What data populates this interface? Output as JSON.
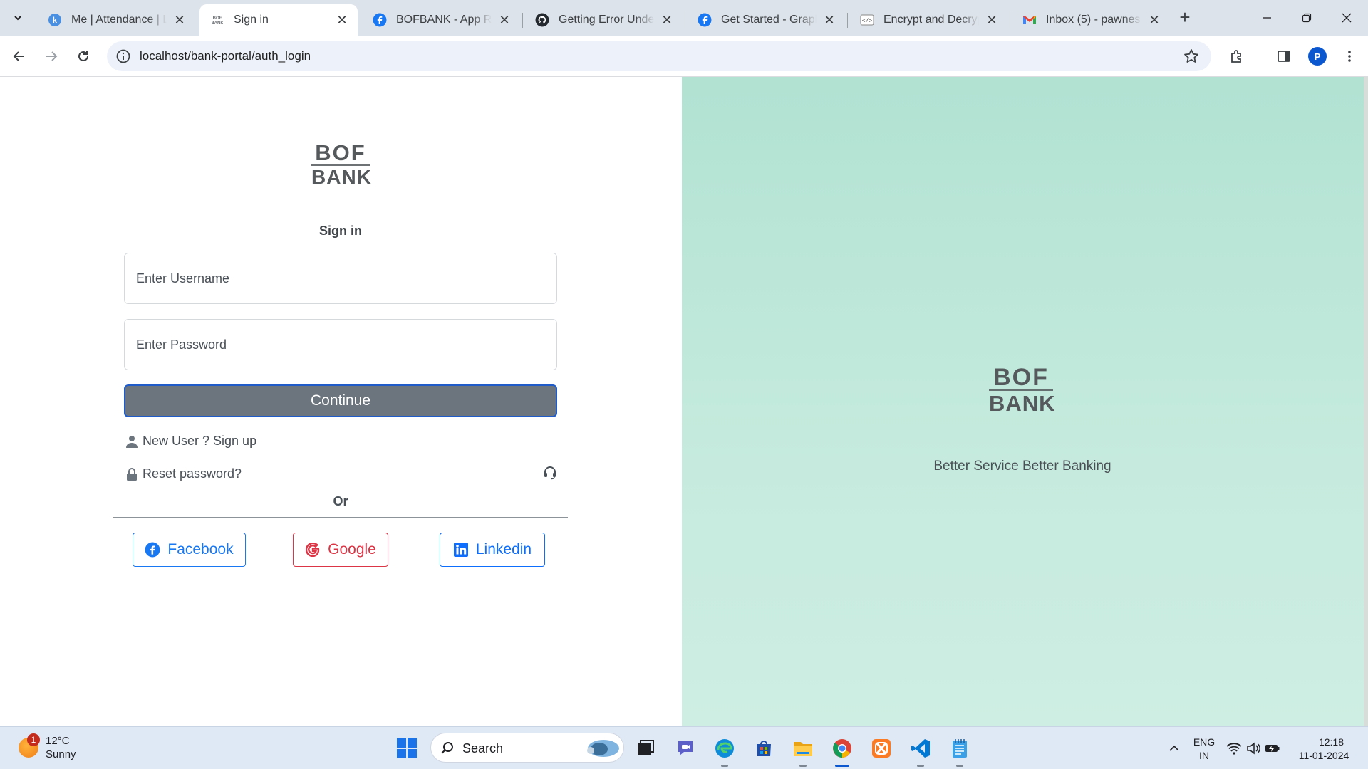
{
  "browser": {
    "tabs": [
      {
        "title": "Me | Attendance | Lo",
        "favicon": "k-circle-icon",
        "active": false
      },
      {
        "title": "Sign in",
        "favicon": "bofbank-favicon",
        "active": true
      },
      {
        "title": "BOFBANK - App Revi",
        "favicon": "facebook-icon",
        "active": false
      },
      {
        "title": "Getting Error Undefi",
        "favicon": "github-icon",
        "active": false
      },
      {
        "title": "Get Started - Graph",
        "favicon": "facebook-icon",
        "active": false
      },
      {
        "title": "Encrypt and Decrypt",
        "favicon": "code-icon",
        "active": false
      },
      {
        "title": "Inbox (5) - pawneshk",
        "favicon": "gmail-icon",
        "active": false
      }
    ],
    "url": "localhost/bank-portal/auth_login",
    "profile_initial": "P"
  },
  "left_logo": {
    "line1": "BOF",
    "line2": "BANK"
  },
  "signin": {
    "title": "Sign in",
    "username_placeholder": "Enter Username",
    "password_placeholder": "Enter Password",
    "continue_label": "Continue",
    "signup_link": "New User ? Sign up",
    "reset_link": "Reset password?",
    "or_label": "Or"
  },
  "social": {
    "facebook": "Facebook",
    "google": "Google",
    "linkedin": "Linkedin"
  },
  "right_panel": {
    "logo": {
      "line1": "BOF",
      "line2": "BANK"
    },
    "tagline": "Better Service Better Banking"
  },
  "taskbar": {
    "weather_temp": "12°C",
    "weather_desc": "Sunny",
    "weather_badge": "1",
    "search_label": "Search",
    "lang_top": "ENG",
    "lang_bottom": "IN",
    "time": "12:18",
    "date": "11-01-2024"
  },
  "colors": {
    "right_panel_bg": "#b1e2d2",
    "continue_bg": "#6c757d",
    "facebook": "#1877f2",
    "google": "#dc3545",
    "linkedin": "#0d6efd"
  }
}
